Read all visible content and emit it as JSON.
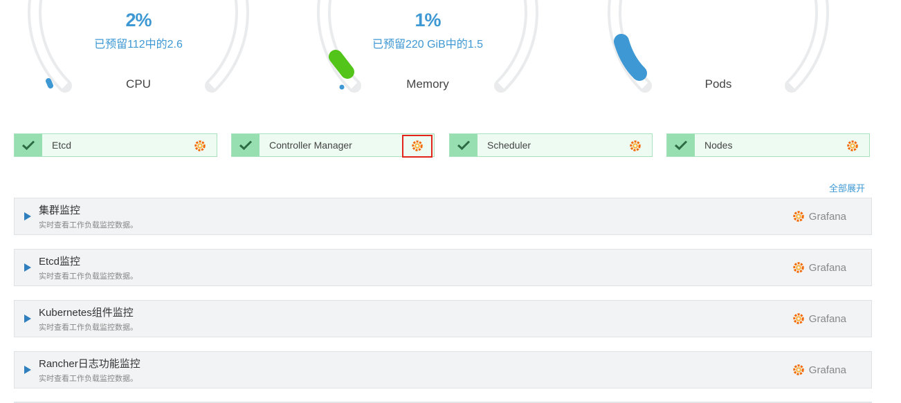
{
  "gauges": [
    {
      "name": "CPU",
      "percent": "2%",
      "detail": "已预留112中的2.6",
      "reserved_fraction": 0.02,
      "accent": "#3d98d3"
    },
    {
      "name": "Memory",
      "percent": "1%",
      "detail": "已预留220 GiB中的1.5",
      "reserved_fraction": 0.01,
      "accent": "#52c41a"
    },
    {
      "name": "Pods",
      "percent": "",
      "detail": "",
      "accent": "#3d98d3"
    }
  ],
  "components": [
    {
      "label": "Etcd",
      "status": "healthy"
    },
    {
      "label": "Controller Manager",
      "status": "healthy"
    },
    {
      "label": "Scheduler",
      "status": "healthy"
    },
    {
      "label": "Nodes",
      "status": "healthy"
    }
  ],
  "expand_all_label": "全部展开",
  "panels": [
    {
      "title": "集群监控",
      "description": "实时查看工作负载监控数据。",
      "link": "Grafana"
    },
    {
      "title": "Etcd监控",
      "description": "实时查看工作负载监控数据。",
      "link": "Grafana"
    },
    {
      "title": "Kubernetes组件监控",
      "description": "实时查看工作负载监控数据。",
      "link": "Grafana"
    },
    {
      "title": "Rancher日志功能监控",
      "description": "实时查看工作负载监控数据。",
      "link": "Grafana"
    }
  ],
  "colors": {
    "accent_blue": "#3d98d3",
    "healthy_bg": "#eefbf2",
    "healthy_check": "#97dfb0",
    "grafana_orange": "#f46800",
    "highlight_red": "#e2231a"
  }
}
